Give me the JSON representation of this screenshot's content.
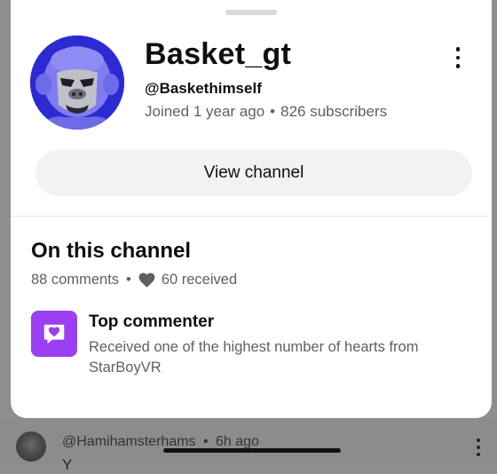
{
  "channel": {
    "name": "Basket_gt",
    "handle": "@Baskethimself",
    "joined": "Joined 1 year ago",
    "subscribers": "826 subscribers",
    "separator": "•",
    "view_channel_label": "View channel"
  },
  "on_channel": {
    "title": "On this channel",
    "comments": "88 comments",
    "separator": "•",
    "hearts_received": "60 received"
  },
  "badge": {
    "title": "Top commenter",
    "description": "Received one of the highest number of hearts from StarBoyVR",
    "icon": "heart-message-icon",
    "color": "#9b3ff3"
  },
  "background_comment": {
    "author": "@Hamihamsterhams",
    "separator": "•",
    "time": "6h ago",
    "text_fragment": "Y"
  },
  "colors": {
    "avatar_bg": "#2c2bd2",
    "scrim": "#8e8e8e",
    "secondary_text": "#606060"
  }
}
